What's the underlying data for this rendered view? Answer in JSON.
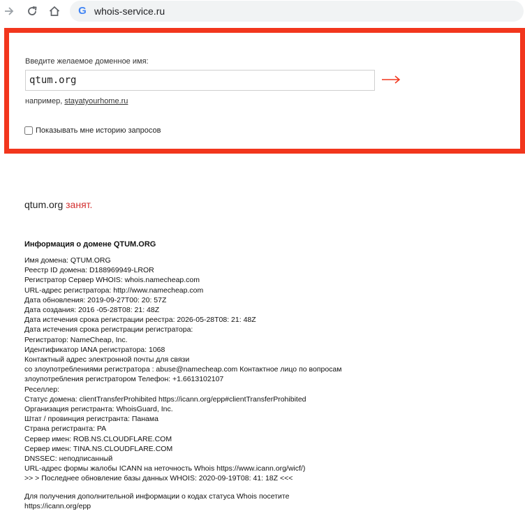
{
  "browser": {
    "url": "whois-service.ru",
    "icons": [
      "forward-arrow-icon",
      "reload-icon",
      "home-icon",
      "google-icon"
    ]
  },
  "search": {
    "label": "Введите желаемое доменное имя:",
    "value": "qtum.org",
    "example_prefix": "например,",
    "example_link": "stayatyourhome.ru",
    "history_label": "Показывать мне историю запросов",
    "history_checked": false,
    "accent_color": "#f2361d"
  },
  "result": {
    "domain": "qtum.org",
    "status": "занят."
  },
  "info": {
    "title": "Информация о домене QTUM.ORG",
    "lines": [
      "Имя домена: QTUM.ORG",
      "Реестр ID домена: D188969949-LROR",
      "Регистратор Сервер WHOIS: whois.namecheap.com",
      "URL-адрес регистратора: http://www.namecheap.com",
      "Дата обновления: 2019-09-27T00: 20: 57Z",
      "Дата создания: 2016 -05-28T08: 21: 48Z",
      "Дата истечения срока регистрации реестра: 2026-05-28T08: 21: 48Z",
      "Дата истечения срока регистрации регистратора:",
      "Регистратор: NameCheap, Inc.",
      "Идентификатор IANA регистратора: 1068",
      "Контактный адрес электронной почты для связи",
      "со злоупотреблениями регистратора : abuse@namecheap.com Контактное лицо по вопросам",
      "злоупотребления регистратором Телефон: +1.6613102107",
      "Реселлер:",
      "Статус домена: clientTransferProhibited https://icann.org/epp#clientTransferProhibited",
      "Организация регистранта: WhoisGuard, Inc.",
      "Штат / провинция регистранта: Панама",
      "Страна регистранта: PA",
      "Сервер имен: ROB.NS.CLOUDFLARE.COM",
      "Сервер имен: TINA.NS.CLOUDFLARE.COM",
      "DNSSEC: неподписанный",
      "URL-адрес формы жалобы ICANN на неточность Whois https://www.icann.org/wicf/)",
      ">> > Последнее обновление базы данных WHOIS: 2020-09-19T08: 41: 18Z <<<"
    ],
    "footer": [
      "Для получения дополнительной информации о кодах статуса Whois посетите",
      "https://icann.org/epp"
    ]
  }
}
